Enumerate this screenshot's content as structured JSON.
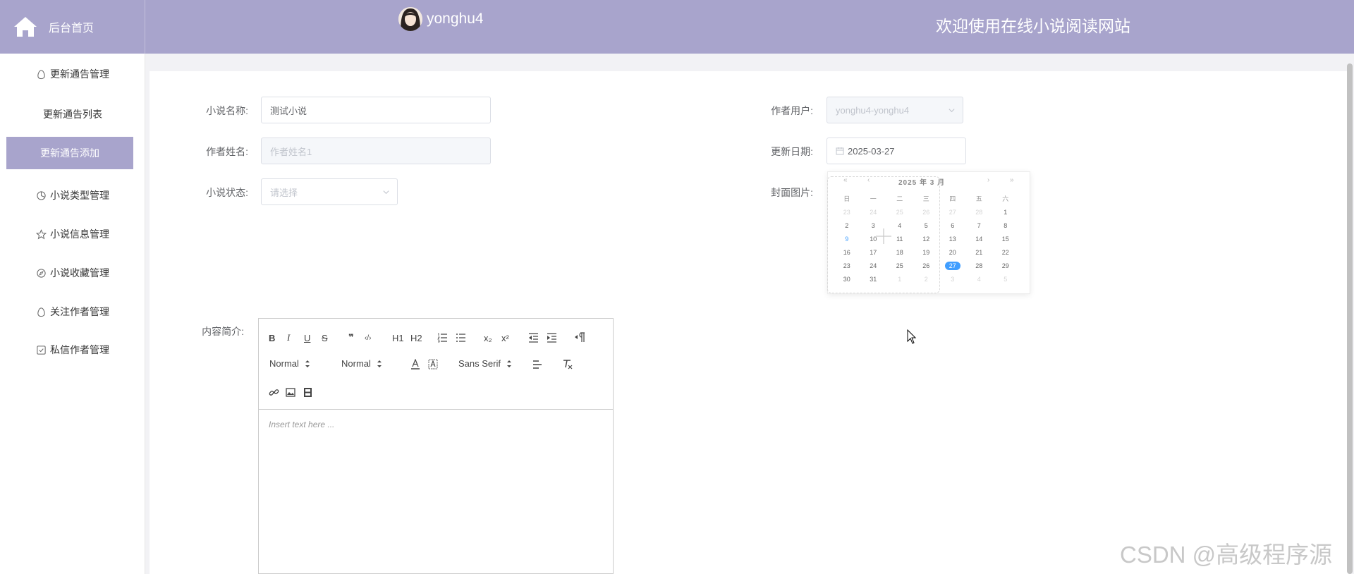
{
  "header": {
    "brand": "后台首页",
    "username": "yonghu4",
    "welcome": "欢迎使用在线小说阅读网站"
  },
  "sidebar": {
    "items": [
      {
        "label": "更新通告管理",
        "icon": "egg-icon"
      },
      {
        "label": "更新通告列表",
        "icon": ""
      },
      {
        "label": "更新通告添加",
        "icon": "",
        "active": true
      },
      {
        "label": "小说类型管理",
        "icon": "pie-icon"
      },
      {
        "label": "小说信息管理",
        "icon": "star-icon"
      },
      {
        "label": "小说收藏管理",
        "icon": "compass-icon"
      },
      {
        "label": "关注作者管理",
        "icon": "egg-icon"
      },
      {
        "label": "私信作者管理",
        "icon": "checkbox-icon"
      }
    ]
  },
  "form": {
    "novel_name_label": "小说名称:",
    "novel_name_value": "测试小说",
    "author_name_label": "作者姓名:",
    "author_name_placeholder": "作者姓名1",
    "status_label": "小说状态:",
    "status_placeholder": "请选择",
    "author_user_label": "作者用户:",
    "author_user_value": "yonghu4-yonghu4",
    "update_date_label": "更新日期:",
    "update_date_value": "2025-03-27",
    "cover_label": "封面图片:",
    "content_label": "内容简介:"
  },
  "calendar": {
    "title": "2025 年 3 月",
    "prev_year": "«",
    "prev_month": "‹",
    "next_month": "›",
    "next_year": "»",
    "weekdays": [
      "日",
      "一",
      "二",
      "三",
      "四",
      "五",
      "六"
    ],
    "weeks": [
      [
        "23",
        "24",
        "25",
        "26",
        "27",
        "28",
        "1"
      ],
      [
        "2",
        "3",
        "4",
        "5",
        "6",
        "7",
        "8"
      ],
      [
        "9",
        "10",
        "11",
        "12",
        "13",
        "14",
        "15"
      ],
      [
        "16",
        "17",
        "18",
        "19",
        "20",
        "21",
        "22"
      ],
      [
        "23",
        "24",
        "25",
        "26",
        "27",
        "28",
        "29"
      ],
      [
        "30",
        "31",
        "1",
        "2",
        "3",
        "4",
        "5"
      ]
    ],
    "selected": "27"
  },
  "editor": {
    "h1": "H1",
    "h2": "H2",
    "bold": "B",
    "italic": "I",
    "underline": "U",
    "strike": "S",
    "quote": "❞",
    "code": "‹/›",
    "sub": "x₂",
    "sup": "x²",
    "size_select": "Normal",
    "header_select": "Normal",
    "font_select": "Sans Serif",
    "placeholder": "Insert text here ..."
  },
  "watermark": "CSDN @高级程序源"
}
